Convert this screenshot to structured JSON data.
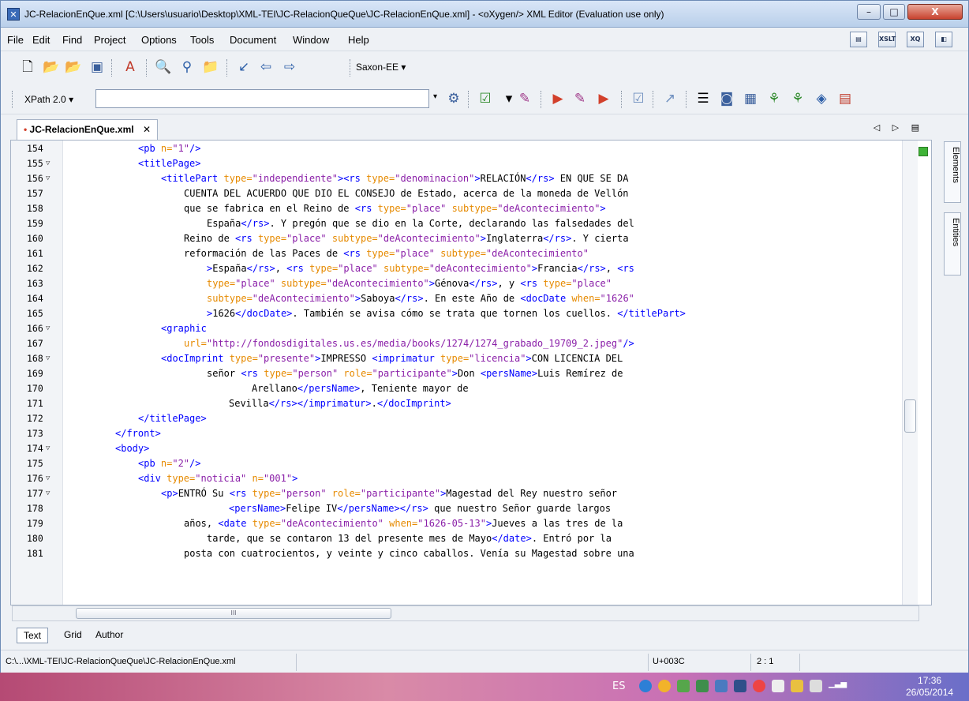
{
  "window": {
    "title": "JC-RelacionEnQue.xml [C:\\Users\\usuario\\Desktop\\XML-TEI\\JC-RelacionQueQue\\JC-RelacionEnQue.xml] - <oXygen/> XML Editor (Evaluation use only)",
    "min_glyph": "–",
    "max_glyph": "□",
    "close_glyph": "X"
  },
  "menu": [
    "File",
    "Edit",
    "Find",
    "Project",
    "Options",
    "Tools",
    "Document",
    "Window",
    "Help"
  ],
  "menu_right": [
    "view-icon",
    "XSLT",
    "XQ",
    "debug-icon"
  ],
  "toolbar1": {
    "transformer": "Saxon-EE",
    "dropdown_glyph": "▾"
  },
  "toolbar2": {
    "xpath_label": "XPath 2.0",
    "dropdown_glyph": "▾",
    "xpath_value": ""
  },
  "tab": {
    "label": "JC-RelacionEnQue.xml",
    "modified_mark": "•",
    "close_glyph": "✕",
    "nav": "◁ ▷ ▤"
  },
  "side_tabs": [
    "Elements",
    "Entities"
  ],
  "code": [
    {
      "n": "154",
      "fold": "",
      "indent": 12,
      "segs": [
        [
          "t",
          "<pb "
        ],
        [
          "a",
          "n="
        ],
        [
          "v",
          "\"1\""
        ],
        [
          "t",
          "/>"
        ]
      ]
    },
    {
      "n": "155",
      "fold": "▽",
      "indent": 12,
      "segs": [
        [
          "t",
          "<titlePage>"
        ]
      ]
    },
    {
      "n": "156",
      "fold": "▽",
      "indent": 16,
      "segs": [
        [
          "t",
          "<titlePart "
        ],
        [
          "a",
          "type="
        ],
        [
          "v",
          "\"independiente\""
        ],
        [
          "t",
          "><rs "
        ],
        [
          "a",
          "type="
        ],
        [
          "v",
          "\"denominacion\""
        ],
        [
          "t",
          ">"
        ],
        [
          "x",
          "RELACIÓN"
        ],
        [
          "t",
          "</rs>"
        ],
        [
          "x",
          " EN QUE SE DA"
        ]
      ]
    },
    {
      "n": "157",
      "fold": "",
      "indent": 20,
      "segs": [
        [
          "x",
          "CUENTA DEL ACUERDO QUE DIO EL CONSEJO de Estado, acerca de la moneda de Vellón"
        ]
      ]
    },
    {
      "n": "158",
      "fold": "",
      "indent": 20,
      "segs": [
        [
          "x",
          "que se fabrica en el Reino de "
        ],
        [
          "t",
          "<rs "
        ],
        [
          "a",
          "type="
        ],
        [
          "v",
          "\"place\" "
        ],
        [
          "a",
          "subtype="
        ],
        [
          "v",
          "\"deAcontecimiento\""
        ],
        [
          "t",
          ">"
        ]
      ]
    },
    {
      "n": "159",
      "fold": "",
      "indent": 24,
      "segs": [
        [
          "x",
          "España"
        ],
        [
          "t",
          "</rs>"
        ],
        [
          "x",
          ". Y pregón que se dio en la Corte, declarando las falsedades del"
        ]
      ]
    },
    {
      "n": "160",
      "fold": "",
      "indent": 20,
      "segs": [
        [
          "x",
          "Reino de "
        ],
        [
          "t",
          "<rs "
        ],
        [
          "a",
          "type="
        ],
        [
          "v",
          "\"place\" "
        ],
        [
          "a",
          "subtype="
        ],
        [
          "v",
          "\"deAcontecimiento\""
        ],
        [
          "t",
          ">"
        ],
        [
          "x",
          "Inglaterra"
        ],
        [
          "t",
          "</rs>"
        ],
        [
          "x",
          ". Y cierta"
        ]
      ]
    },
    {
      "n": "161",
      "fold": "",
      "indent": 20,
      "segs": [
        [
          "x",
          "reformación de las Paces de "
        ],
        [
          "t",
          "<rs "
        ],
        [
          "a",
          "type="
        ],
        [
          "v",
          "\"place\" "
        ],
        [
          "a",
          "subtype="
        ],
        [
          "v",
          "\"deAcontecimiento\""
        ]
      ]
    },
    {
      "n": "162",
      "fold": "",
      "indent": 24,
      "segs": [
        [
          "t",
          ">"
        ],
        [
          "x",
          "España"
        ],
        [
          "t",
          "</rs>"
        ],
        [
          "x",
          ", "
        ],
        [
          "t",
          "<rs "
        ],
        [
          "a",
          "type="
        ],
        [
          "v",
          "\"place\" "
        ],
        [
          "a",
          "subtype="
        ],
        [
          "v",
          "\"deAcontecimiento\""
        ],
        [
          "t",
          ">"
        ],
        [
          "x",
          "Francia"
        ],
        [
          "t",
          "</rs>"
        ],
        [
          "x",
          ", "
        ],
        [
          "t",
          "<rs"
        ]
      ]
    },
    {
      "n": "163",
      "fold": "",
      "indent": 24,
      "segs": [
        [
          "a",
          "type="
        ],
        [
          "v",
          "\"place\" "
        ],
        [
          "a",
          "subtype="
        ],
        [
          "v",
          "\"deAcontecimiento\""
        ],
        [
          "t",
          ">"
        ],
        [
          "x",
          "Génova"
        ],
        [
          "t",
          "</rs>"
        ],
        [
          "x",
          ", y "
        ],
        [
          "t",
          "<rs "
        ],
        [
          "a",
          "type="
        ],
        [
          "v",
          "\"place\""
        ]
      ]
    },
    {
      "n": "164",
      "fold": "",
      "indent": 24,
      "segs": [
        [
          "a",
          "subtype="
        ],
        [
          "v",
          "\"deAcontecimiento\""
        ],
        [
          "t",
          ">"
        ],
        [
          "x",
          "Saboya"
        ],
        [
          "t",
          "</rs>"
        ],
        [
          "x",
          ". En este Año de "
        ],
        [
          "t",
          "<docDate "
        ],
        [
          "a",
          "when="
        ],
        [
          "v",
          "\"1626\""
        ]
      ]
    },
    {
      "n": "165",
      "fold": "",
      "indent": 24,
      "segs": [
        [
          "t",
          ">"
        ],
        [
          "x",
          "1626"
        ],
        [
          "t",
          "</docDate>"
        ],
        [
          "x",
          ". También se avisa cómo se trata que tornen los cuellos. "
        ],
        [
          "t",
          "</titlePart>"
        ]
      ]
    },
    {
      "n": "166",
      "fold": "▽",
      "indent": 16,
      "segs": [
        [
          "t",
          "<graphic"
        ]
      ]
    },
    {
      "n": "167",
      "fold": "",
      "indent": 20,
      "segs": [
        [
          "a",
          "url="
        ],
        [
          "v",
          "\"http://fondosdigitales.us.es/media/books/1274/1274_grabado_19709_2.jpeg\""
        ],
        [
          "t",
          "/>"
        ]
      ]
    },
    {
      "n": "168",
      "fold": "▽",
      "indent": 16,
      "segs": [
        [
          "t",
          "<docImprint "
        ],
        [
          "a",
          "type="
        ],
        [
          "v",
          "\"presente\""
        ],
        [
          "t",
          ">"
        ],
        [
          "x",
          "IMPRESSO "
        ],
        [
          "t",
          "<imprimatur "
        ],
        [
          "a",
          "type="
        ],
        [
          "v",
          "\"licencia\""
        ],
        [
          "t",
          ">"
        ],
        [
          "x",
          "CON LICENCIA DEL"
        ]
      ]
    },
    {
      "n": "169",
      "fold": "",
      "indent": 24,
      "segs": [
        [
          "x",
          "señor "
        ],
        [
          "t",
          "<rs "
        ],
        [
          "a",
          "type="
        ],
        [
          "v",
          "\"person\" "
        ],
        [
          "a",
          "role="
        ],
        [
          "v",
          "\"participante\""
        ],
        [
          "t",
          ">"
        ],
        [
          "x",
          "Don "
        ],
        [
          "t",
          "<persName>"
        ],
        [
          "x",
          "Luis Remírez de"
        ]
      ]
    },
    {
      "n": "170",
      "fold": "",
      "indent": 32,
      "segs": [
        [
          "x",
          "Arellano"
        ],
        [
          "t",
          "</persName>"
        ],
        [
          "x",
          ", Teniente mayor de"
        ]
      ]
    },
    {
      "n": "171",
      "fold": "",
      "indent": 28,
      "segs": [
        [
          "x",
          "Sevilla"
        ],
        [
          "t",
          "</rs></imprimatur>"
        ],
        [
          "x",
          "."
        ],
        [
          "t",
          "</docImprint>"
        ]
      ]
    },
    {
      "n": "172",
      "fold": "",
      "indent": 12,
      "segs": [
        [
          "t",
          "</titlePage>"
        ]
      ]
    },
    {
      "n": "173",
      "fold": "",
      "indent": 8,
      "segs": [
        [
          "t",
          "</front>"
        ]
      ]
    },
    {
      "n": "174",
      "fold": "▽",
      "indent": 8,
      "segs": [
        [
          "t",
          "<body>"
        ]
      ]
    },
    {
      "n": "175",
      "fold": "",
      "indent": 12,
      "segs": [
        [
          "t",
          "<pb "
        ],
        [
          "a",
          "n="
        ],
        [
          "v",
          "\"2\""
        ],
        [
          "t",
          "/>"
        ]
      ]
    },
    {
      "n": "176",
      "fold": "▽",
      "indent": 12,
      "segs": [
        [
          "t",
          "<div "
        ],
        [
          "a",
          "type="
        ],
        [
          "v",
          "\"noticia\" "
        ],
        [
          "a",
          "n="
        ],
        [
          "v",
          "\"001\""
        ],
        [
          "t",
          ">"
        ]
      ]
    },
    {
      "n": "177",
      "fold": "▽",
      "indent": 16,
      "segs": [
        [
          "t",
          "<p>"
        ],
        [
          "x",
          "ENTRÓ Su "
        ],
        [
          "t",
          "<rs "
        ],
        [
          "a",
          "type="
        ],
        [
          "v",
          "\"person\" "
        ],
        [
          "a",
          "role="
        ],
        [
          "v",
          "\"participante\""
        ],
        [
          "t",
          ">"
        ],
        [
          "x",
          "Magestad del Rey nuestro señor"
        ]
      ]
    },
    {
      "n": "178",
      "fold": "",
      "indent": 28,
      "segs": [
        [
          "t",
          "<persName>"
        ],
        [
          "x",
          "Felipe IV"
        ],
        [
          "t",
          "</persName></rs>"
        ],
        [
          "x",
          " que nuestro Señor guarde largos"
        ]
      ]
    },
    {
      "n": "179",
      "fold": "",
      "indent": 20,
      "segs": [
        [
          "x",
          "años, "
        ],
        [
          "t",
          "<date "
        ],
        [
          "a",
          "type="
        ],
        [
          "v",
          "\"deAcontecimiento\" "
        ],
        [
          "a",
          "when="
        ],
        [
          "v",
          "\"1626-05-13\""
        ],
        [
          "t",
          ">"
        ],
        [
          "x",
          "Jueves a las tres de la"
        ]
      ]
    },
    {
      "n": "180",
      "fold": "",
      "indent": 24,
      "segs": [
        [
          "x",
          "tarde, que se contaron 13 del presente mes de Mayo"
        ],
        [
          "t",
          "</date>"
        ],
        [
          "x",
          ". Entró por la"
        ]
      ]
    },
    {
      "n": "181",
      "fold": "",
      "indent": 20,
      "segs": [
        [
          "x",
          "posta con cuatrocientos, y veinte y cinco caballos. Venía su Magestad sobre una"
        ]
      ]
    }
  ],
  "hscroll_grip": "III",
  "modes": [
    "Text",
    "Grid",
    "Author"
  ],
  "status": {
    "path": "C:\\...\\XML-TEI\\JC-RelacionQueQue\\JC-RelacionEnQue.xml",
    "unicode": "U+003C",
    "position": "2 : 1"
  },
  "taskbar": {
    "lang": "ES",
    "time": "17:36",
    "date": "26/05/2014"
  }
}
